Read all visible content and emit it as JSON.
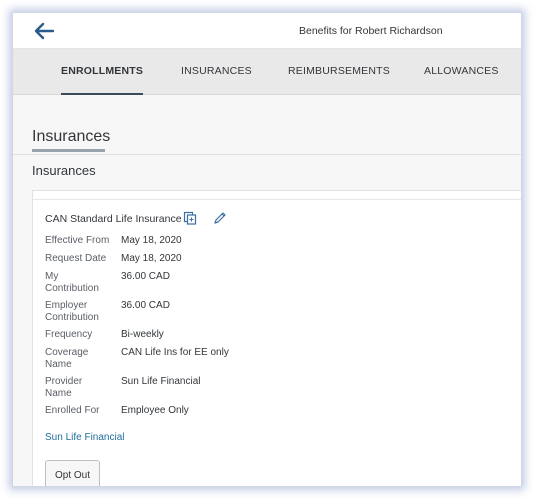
{
  "header": {
    "title": "Benefits for Robert Richardson",
    "back_icon": "arrow-left-icon"
  },
  "tabs": [
    {
      "label": "ENROLLMENTS",
      "active": true
    },
    {
      "label": "INSURANCES",
      "active": false
    },
    {
      "label": "REIMBURSEMENTS",
      "active": false
    },
    {
      "label": "ALLOWANCES",
      "active": false
    }
  ],
  "section": {
    "title": "Insurances",
    "subtitle": "Insurances"
  },
  "plan": {
    "name": "CAN Standard Life Insurance",
    "icons": [
      "copy-icon",
      "edit-icon"
    ],
    "fields": [
      {
        "label": "Effective From",
        "value": "May 18, 2020"
      },
      {
        "label": "Request Date",
        "value": "May 18, 2020"
      },
      {
        "label": "My Contribution",
        "value": "36.00 CAD"
      },
      {
        "label": "Employer Contribution",
        "value": "36.00 CAD"
      },
      {
        "label": "Frequency",
        "value": "Bi-weekly"
      },
      {
        "label": "Coverage Name",
        "value": "CAN Life Ins for EE only"
      },
      {
        "label": "Provider Name",
        "value": "Sun Life Financial"
      },
      {
        "label": "Enrolled For",
        "value": "Employee Only"
      }
    ],
    "provider_link": "Sun Life Financial",
    "opt_out_label": "Opt Out"
  },
  "colors": {
    "link": "#1f6f9f",
    "tab_underline": "#3b4a5c",
    "frame_glow": "#788cc8"
  }
}
